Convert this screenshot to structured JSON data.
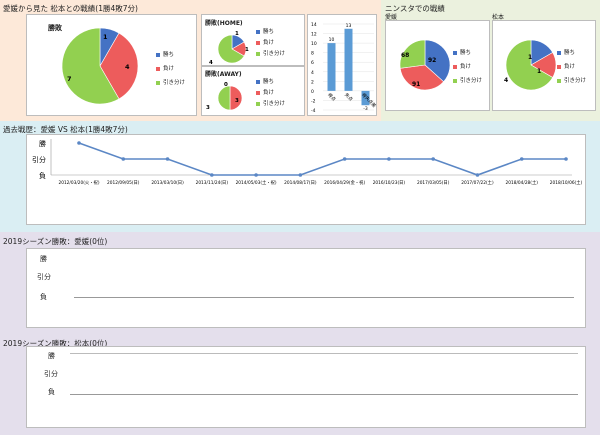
{
  "colors": {
    "win": "#4472c4",
    "lose": "#ed5c5c",
    "draw": "#92d050",
    "line": "#5b87c5",
    "bar": "#5b9bd5"
  },
  "top_section": {
    "title": "愛媛から見た 松本との戦績(1勝4敗7分)",
    "main_pie": {
      "title": "勝敗",
      "win": 1,
      "lose": 4,
      "draw": 7
    },
    "home_pie": {
      "title": "勝敗(HOME)",
      "win": 1,
      "lose": 1,
      "draw": 4
    },
    "away_pie": {
      "title": "勝敗(AWAY)",
      "win": 0,
      "lose": 3,
      "draw": 3
    },
    "legend": {
      "win": "勝ち",
      "lose": "負け",
      "draw": "引き分け"
    },
    "goals_chart": {
      "categories": [
        "得点",
        "失点",
        "得失点差"
      ],
      "values": [
        10,
        13,
        -3
      ],
      "yticks": [
        "14",
        "12",
        "10",
        "8",
        "6",
        "4",
        "2",
        "0",
        "-2",
        "-4"
      ]
    }
  },
  "ninsta_section": {
    "title": "ニンスタでの戦績",
    "ehime": {
      "title": "愛媛",
      "win": 92,
      "lose": 91,
      "draw": 68
    },
    "matsumoto": {
      "title": "松本",
      "win": 1,
      "lose": 1,
      "draw": 4
    }
  },
  "history_section": {
    "title": "過去戦歴：愛媛 VS 松本(1勝4敗7分)",
    "ylabels": {
      "win": "勝",
      "draw": "引分",
      "lose": "負"
    },
    "dates": [
      "2012/03/20(火・祝)",
      "2012/09/05(日)",
      "2013/03/10(日)",
      "2013/11/24(日)",
      "2014/05/03(土・祝)",
      "2014/08/17(日)",
      "2016/04/29(金・祝)",
      "2016/10/23(日)",
      "2017/03/05(日)",
      "2017/07/22(土)",
      "2018/04/28(土)",
      "2018/10/06(土)"
    ],
    "results": [
      1,
      0,
      0,
      -1,
      -1,
      -1,
      0,
      0,
      0,
      -1,
      0,
      0
    ]
  },
  "season_ehime": {
    "title": "2019シーズン勝敗：愛媛(0位)",
    "ylabels": {
      "win": "勝",
      "draw": "引分",
      "lose": "負"
    }
  },
  "season_matsumoto": {
    "title": "2019シーズン勝敗：松本(0位)",
    "ylabels": {
      "win": "勝",
      "draw": "引分",
      "lose": "負"
    }
  }
}
